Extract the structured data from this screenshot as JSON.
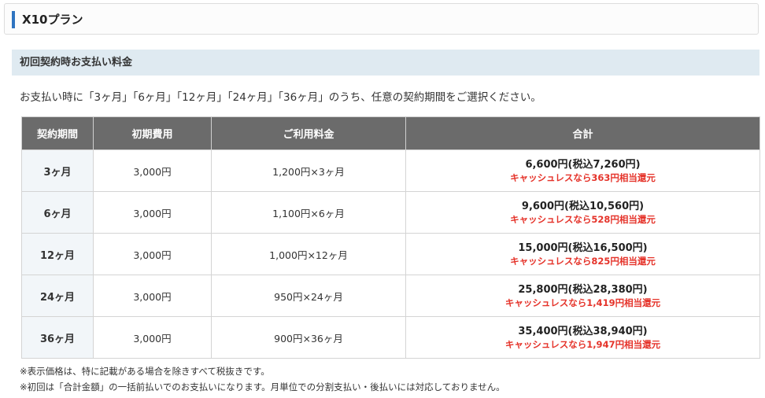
{
  "plan_header": {
    "title": "X10プラン"
  },
  "section": {
    "title": "初回契約時お支払い料金"
  },
  "lead_text": "お支払い時に「3ヶ月」「6ヶ月」「12ヶ月」「24ヶ月」「36ヶ月」のうち、任意の契約期間をご選択ください。",
  "table": {
    "headers": [
      "契約期間",
      "初期費用",
      "ご利用料金",
      "合計"
    ],
    "rows": [
      {
        "term": "3ヶ月",
        "initial": "3,000円",
        "usage": "1,200円×3ヶ月",
        "total": "6,600円(税込7,260円)",
        "cashless": "キャッシュレスなら363円相当還元"
      },
      {
        "term": "6ヶ月",
        "initial": "3,000円",
        "usage": "1,100円×6ヶ月",
        "total": "9,600円(税込10,560円)",
        "cashless": "キャッシュレスなら528円相当還元"
      },
      {
        "term": "12ヶ月",
        "initial": "3,000円",
        "usage": "1,000円×12ヶ月",
        "total": "15,000円(税込16,500円)",
        "cashless": "キャッシュレスなら825円相当還元"
      },
      {
        "term": "24ヶ月",
        "initial": "3,000円",
        "usage": "950円×24ヶ月",
        "total": "25,800円(税込28,380円)",
        "cashless": "キャッシュレスなら1,419円相当還元"
      },
      {
        "term": "36ヶ月",
        "initial": "3,000円",
        "usage": "900円×36ヶ月",
        "total": "35,400円(税込38,940円)",
        "cashless": "キャッシュレスなら1,947円相当還元"
      }
    ]
  },
  "notes": [
    "※表示価格は、特に記載がある場合を除きすべて税抜きです。",
    "※初回は「合計金額」の一括前払いでのお支払いになります。月単位での分割支払い・後払いには対応しておりません。"
  ],
  "colors": {
    "accent_bar": "#2f74c0",
    "section_bg": "#dfeaf1",
    "header_bg": "#6b6b6b",
    "cashless_red": "#e5332a"
  }
}
